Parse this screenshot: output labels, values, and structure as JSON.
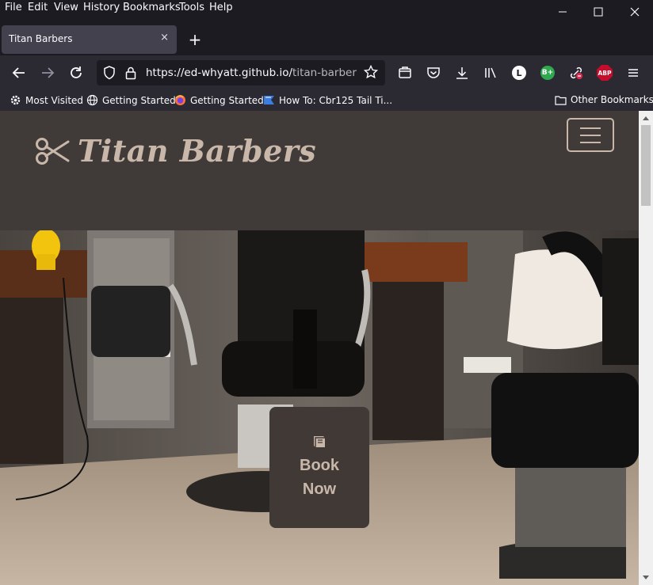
{
  "menubar": {
    "items": [
      "File",
      "Edit",
      "View",
      "History",
      "Bookmarks",
      "Tools",
      "Help"
    ]
  },
  "tab": {
    "title": "Titan Barbers",
    "close": "×"
  },
  "newtab": "+",
  "url": {
    "main": "https://ed-whyatt.github.io/",
    "rest": "titan-barbers/index.html"
  },
  "extensions": {
    "l_badge": "L",
    "b_badge": "B+",
    "abp": "ABP"
  },
  "bookmarks": {
    "items": [
      {
        "label": "Most Visited",
        "icon": "gear-icon"
      },
      {
        "label": "Getting Started",
        "icon": "globe-icon"
      },
      {
        "label": "Getting Started",
        "icon": "firefox-icon"
      },
      {
        "label": "How To: Cbr125 Tail Ti...",
        "icon": "bookmark-flag-icon"
      }
    ],
    "other": "Other Bookmarks"
  },
  "site": {
    "brand": "Titan Barbers",
    "book_now": "Book Now",
    "colors": {
      "header_bg": "#403b39",
      "accent": "#c9b8aa",
      "button_bg": "#403936"
    }
  }
}
